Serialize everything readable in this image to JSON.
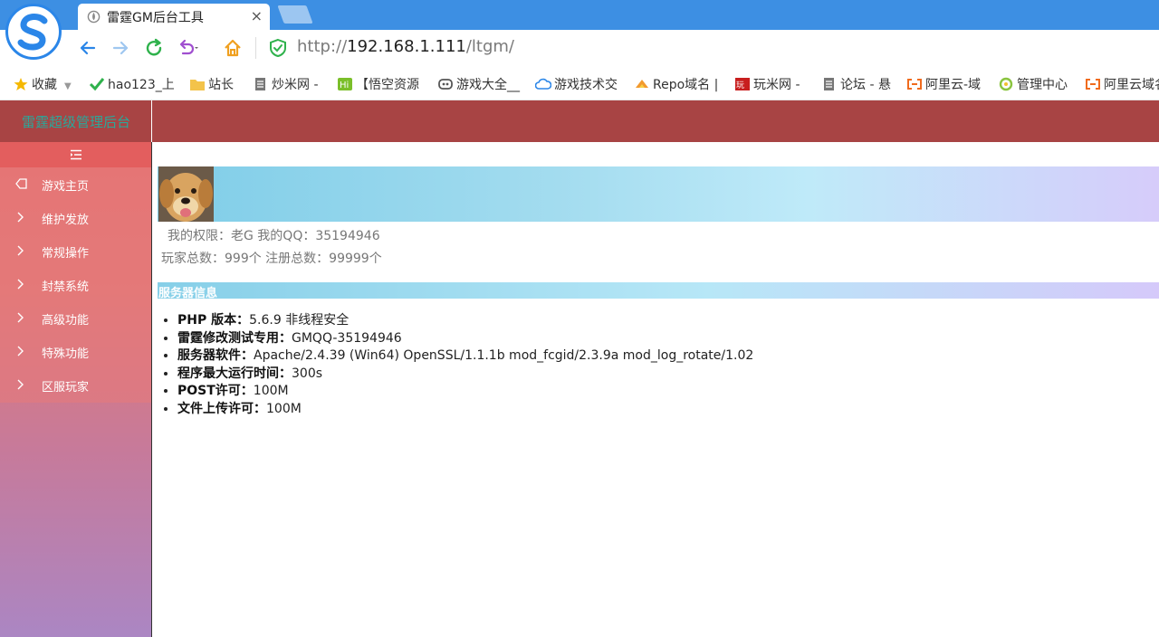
{
  "browser": {
    "tab_title": "雷霆GM后台工具",
    "tab_close": "×",
    "url_prefix": "http://",
    "url_host": "192.168.1.111",
    "url_path": "/ltgm/"
  },
  "bookmarks": [
    {
      "label": "收藏",
      "icon": "star-icon"
    },
    {
      "label": "hao123_上",
      "icon": "hao123-icon"
    },
    {
      "label": "站长",
      "icon": "folder-icon"
    },
    {
      "label": "炒米网 -",
      "icon": "page-icon"
    },
    {
      "label": "【悟空资源",
      "icon": "hi-icon"
    },
    {
      "label": "游戏大全__",
      "icon": "game-icon"
    },
    {
      "label": "游戏技术交",
      "icon": "cloud-icon"
    },
    {
      "label": "Repo域名 |",
      "icon": "repo-icon"
    },
    {
      "label": "玩米网 -",
      "icon": "wan-icon"
    },
    {
      "label": "论坛 - 悬",
      "icon": "page-icon"
    },
    {
      "label": "阿里云-域",
      "icon": "aliyun-icon"
    },
    {
      "label": "管理中心",
      "icon": "manage-icon"
    },
    {
      "label": "阿里云域名",
      "icon": "aliyun-icon"
    }
  ],
  "app": {
    "brand": "雷霆超级管理后台"
  },
  "sidebar": {
    "items": [
      {
        "label": "游戏主页",
        "icon": "tag-icon"
      },
      {
        "label": "维护发放",
        "icon": "chevron-right-icon"
      },
      {
        "label": "常规操作",
        "icon": "chevron-right-icon"
      },
      {
        "label": "封禁系统",
        "icon": "chevron-right-icon"
      },
      {
        "label": "高级功能",
        "icon": "chevron-right-icon"
      },
      {
        "label": "特殊功能",
        "icon": "chevron-right-icon"
      },
      {
        "label": "区服玩家",
        "icon": "chevron-right-icon"
      }
    ]
  },
  "profile": {
    "line1": "我的权限：老G   我的QQ：35194946",
    "line2": "玩家总数：999个  注册总数：99999个"
  },
  "server": {
    "section_title": "服务器信息",
    "items": [
      {
        "key": "PHP 版本：",
        "value": "5.6.9 非线程安全"
      },
      {
        "key": "雷霆修改测试专用：",
        "value": "GMQQ-35194946"
      },
      {
        "key": "服务器软件：",
        "value": "Apache/2.4.39 (Win64) OpenSSL/1.1.1b mod_fcgid/2.3.9a mod_log_rotate/1.02"
      },
      {
        "key": "程序最大运行时间：",
        "value": "300s"
      },
      {
        "key": "POST许可：",
        "value": "100M"
      },
      {
        "key": "文件上传许可：",
        "value": "100M"
      }
    ]
  },
  "colors": {
    "tabbar": "#3d8fe3",
    "header": "#a84444",
    "brand_text": "#2aa89a",
    "sidebar_top": "#e46e6e",
    "sidebar_bottom": "#ab86c3"
  }
}
